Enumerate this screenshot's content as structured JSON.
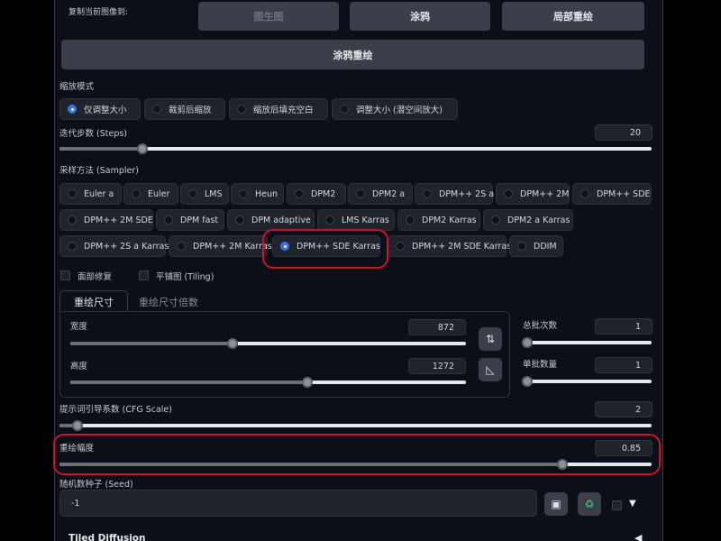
{
  "copy_label": "复制当前图像到:",
  "top_buttons": [
    "图生图",
    "涂鸦",
    "局部重绘"
  ],
  "inpaint_sketch_button": "涂鸦重绘",
  "resize_mode": {
    "label": "缩放模式",
    "options": [
      "仅调整大小",
      "裁剪后缩放",
      "缩放后填充空白",
      "调整大小 (潜空间放大)"
    ],
    "selected": "仅调整大小"
  },
  "steps": {
    "label": "迭代步数 (Steps)",
    "value": "20",
    "fraction": 0.14
  },
  "sampler": {
    "label": "采样方法 (Sampler)",
    "options": [
      "Euler a",
      "Euler",
      "LMS",
      "Heun",
      "DPM2",
      "DPM2 a",
      "DPM++ 2S a",
      "DPM++ 2M",
      "DPM++ SDE",
      "DPM++ 2M SDE",
      "DPM fast",
      "DPM adaptive",
      "LMS Karras",
      "DPM2 Karras",
      "DPM2 a Karras",
      "DPM++ 2S a Karras",
      "DPM++ 2M Karras",
      "DPM++ SDE Karras",
      "DPM++ 2M SDE Karras",
      "DDIM"
    ],
    "selected": "DPM++ SDE Karras"
  },
  "checkboxes": {
    "face_restore": "面部修复",
    "tiling": "平铺图 (Tiling)"
  },
  "size_tabs": [
    "重绘尺寸",
    "重绘尺寸倍数"
  ],
  "width": {
    "label": "宽度",
    "value": "872",
    "fraction": 0.41
  },
  "height": {
    "label": "高度",
    "value": "1272",
    "fraction": 0.6
  },
  "batch_count": {
    "label": "总批次数",
    "value": "1",
    "fraction": 0.0
  },
  "batch_size": {
    "label": "单批数量",
    "value": "1",
    "fraction": 0.0
  },
  "cfg": {
    "label": "提示词引导系数 (CFG Scale)",
    "value": "2",
    "fraction": 0.03
  },
  "denoise": {
    "label": "重绘幅度",
    "value": "0.85",
    "fraction": 0.85
  },
  "seed": {
    "label": "随机数种子 (Seed)",
    "value": "-1"
  },
  "tiled_diffusion": {
    "label": "Tiled Diffusion"
  },
  "colors": {
    "accent": "#3b73e6",
    "highlight": "#d0102a"
  }
}
